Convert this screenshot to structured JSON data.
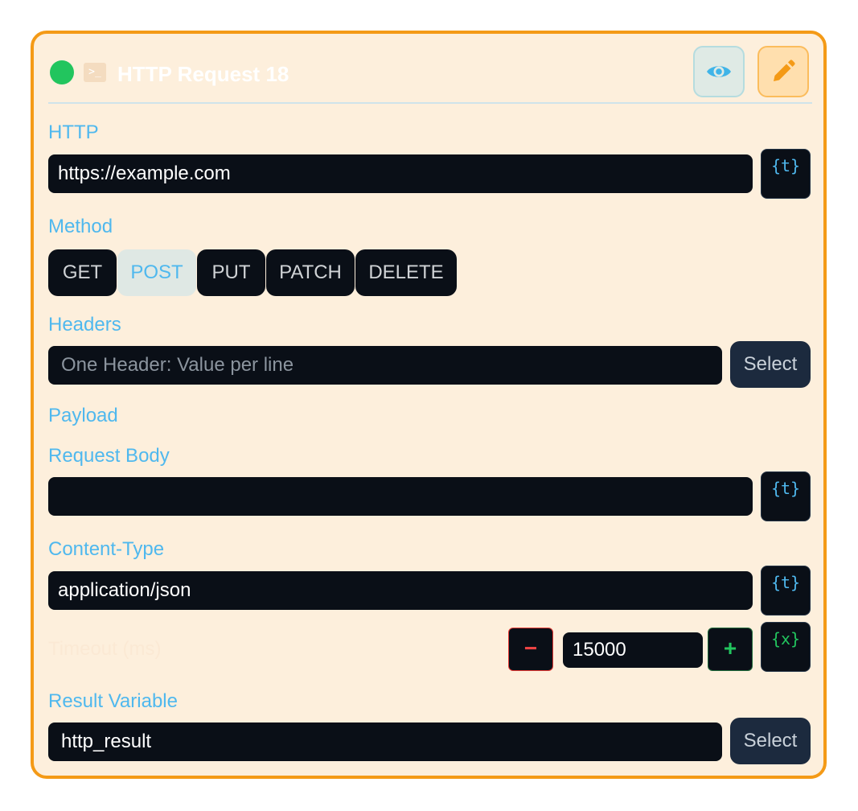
{
  "node": {
    "title": "HTTP Request 18",
    "status_color": "#22c55e",
    "type_icon": "terminal-icon",
    "icon_glyph": ">_"
  },
  "header_actions": {
    "view_icon": "eye-icon",
    "edit_icon": "pencil-icon"
  },
  "url": {
    "label": "HTTP",
    "value": "https://example.com",
    "template_button": "{t}"
  },
  "method": {
    "label": "Method",
    "options": [
      "GET",
      "POST",
      "PUT",
      "PATCH",
      "DELETE"
    ],
    "selected": "POST"
  },
  "headers": {
    "label": "Headers",
    "placeholder": "One Header: Value per line",
    "value": "",
    "select_button": "Select"
  },
  "payload": {
    "section_label": "Payload",
    "body_label": "Request Body",
    "body_value": "",
    "body_template_button": "{t}"
  },
  "content_type": {
    "label": "Content-Type",
    "value": "application/json",
    "template_button": "{t}"
  },
  "timeout": {
    "label": "Timeout (ms)",
    "value": "15000",
    "minus": "−",
    "plus": "+",
    "variable_button": "{x}"
  },
  "result_variable": {
    "label": "Result Variable",
    "value": "http_result",
    "select_button": "Select"
  },
  "colors": {
    "accent_border": "#f49a16",
    "card_bg": "#fdefdc",
    "label": "#4fb8ee",
    "field_bg": "#0a0f17"
  }
}
